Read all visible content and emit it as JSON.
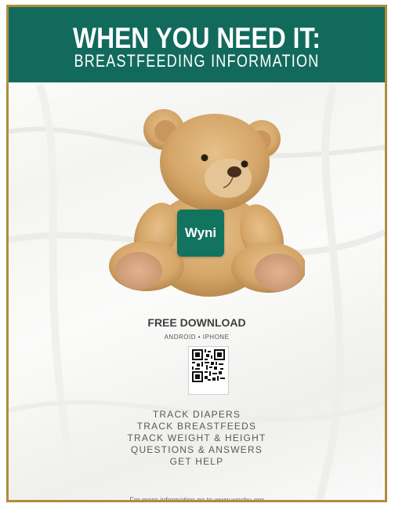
{
  "banner": {
    "title": "WHEN YOU NEED IT:",
    "subtitle": "BREASTFEEDING INFORMATION",
    "color": "#126a5d"
  },
  "app": {
    "name": "Wyni",
    "color": "#12735f"
  },
  "download": {
    "heading": "FREE DOWNLOAD",
    "platforms": "ANDROID • IPHONE"
  },
  "qr": {
    "icon": "qr-code-icon"
  },
  "features": [
    "TRACK DIAPERS",
    "TRACK BREASTFEEDS",
    "TRACK WEIGHT & HEIGHT",
    "QUESTIONS & ANSWERS",
    "GET HELP"
  ],
  "footer": {
    "text": "For more information go to www.wechu.org"
  },
  "border_color": "#b08d3c"
}
